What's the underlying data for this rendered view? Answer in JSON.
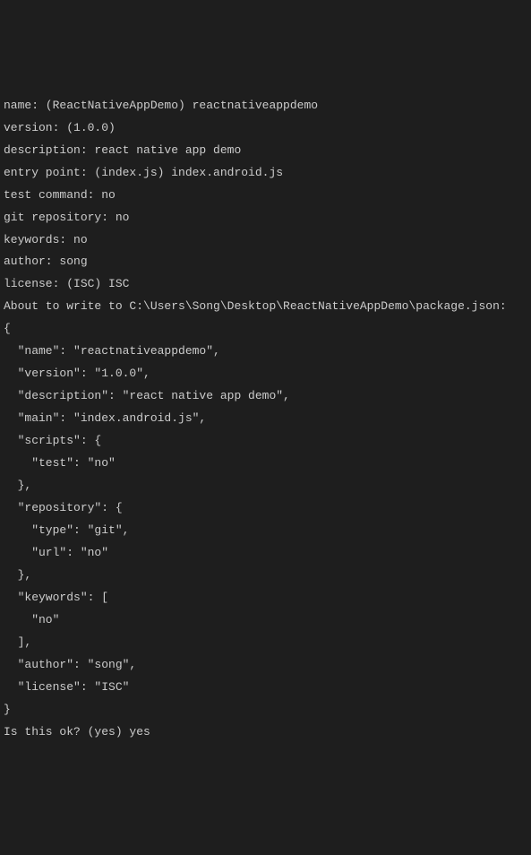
{
  "lines": {
    "l0": "name: (ReactNativeAppDemo) reactnativeappdemo",
    "l1": "version: (1.0.0)",
    "l2": "description: react native app demo",
    "l3": "entry point: (index.js) index.android.js",
    "l4": "test command: no",
    "l5": "git repository: no",
    "l6": "keywords: no",
    "l7": "author: song",
    "l8": "license: (ISC) ISC",
    "l9": "About to write to C:\\Users\\Song\\Desktop\\ReactNativeAppDemo\\package.json:",
    "l10": "",
    "l11": "{",
    "l12": "  \"name\": \"reactnativeappdemo\",",
    "l13": "  \"version\": \"1.0.0\",",
    "l14": "  \"description\": \"react native app demo\",",
    "l15": "  \"main\": \"index.android.js\",",
    "l16": "  \"scripts\": {",
    "l17": "    \"test\": \"no\"",
    "l18": "  },",
    "l19": "  \"repository\": {",
    "l20": "    \"type\": \"git\",",
    "l21": "    \"url\": \"no\"",
    "l22": "  },",
    "l23": "  \"keywords\": [",
    "l24": "    \"no\"",
    "l25": "  ],",
    "l26": "  \"author\": \"song\",",
    "l27": "  \"license\": \"ISC\"",
    "l28": "}",
    "l29": "",
    "l30": "",
    "l31": "Is this ok? (yes) yes"
  }
}
